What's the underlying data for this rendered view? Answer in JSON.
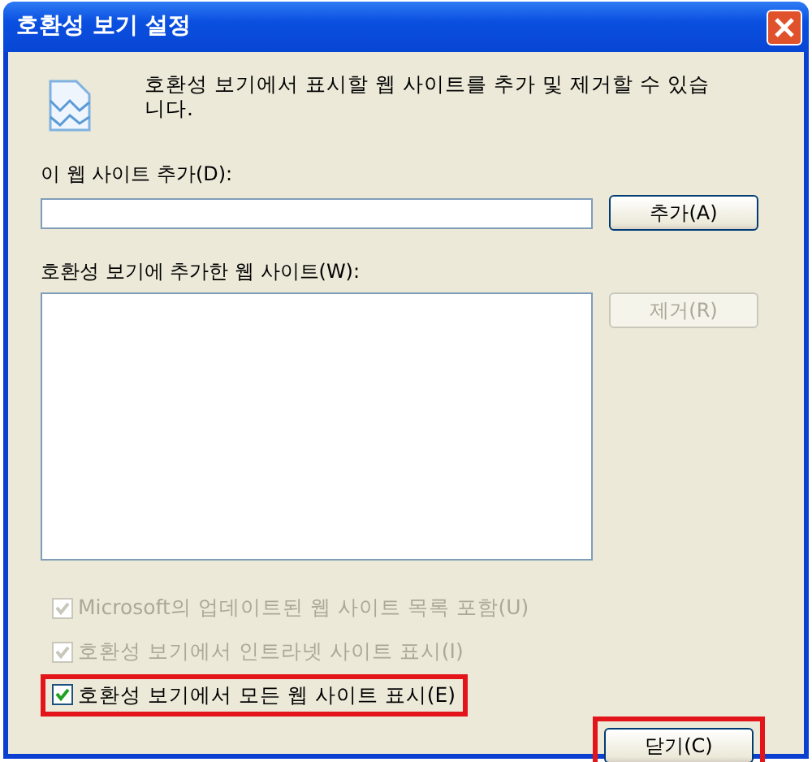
{
  "window": {
    "title": "호환성 보기 설정"
  },
  "intro": "호환성 보기에서 표시할 웹 사이트를 추가 및 제거할 수 있습니다.",
  "add_site": {
    "label": "이 웹 사이트 추가(D):",
    "button": {
      "label": "추가(A)",
      "disabled": false
    }
  },
  "site_list": {
    "label": "호환성 보기에 추가한 웹 사이트(W):",
    "button": {
      "label": "제거(R)",
      "disabled": true
    }
  },
  "options": [
    {
      "label": "Microsoft의 업데이트된 웹 사이트 목록 포함(U)",
      "checked": true,
      "disabled": true,
      "highlighted": false
    },
    {
      "label": "호환성 보기에서 인트라넷 사이트 표시(I)",
      "checked": true,
      "disabled": true,
      "highlighted": false
    },
    {
      "label": "호환성 보기에서 모든 웹 사이트 표시(E)",
      "checked": true,
      "disabled": false,
      "highlighted": true
    }
  ],
  "close_button": {
    "label": "닫기(C)",
    "highlighted": true
  }
}
